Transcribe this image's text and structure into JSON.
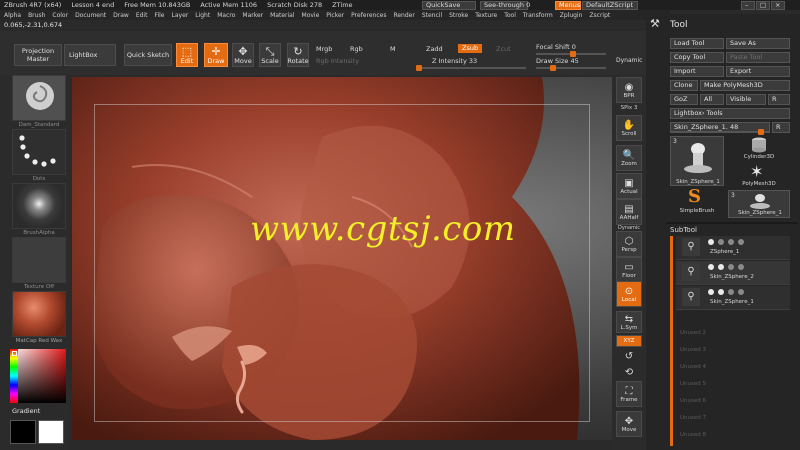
{
  "titlebar": {
    "app": "ZBrush 4R7 (x64)",
    "doc": "Lesson 4 end",
    "free_mem": "Free Mem 10.843GB",
    "active_mem": "Active Mem 1106",
    "scratch": "Scratch Disk 278",
    "ztime": "ZTime",
    "quicksave": "QuickSave",
    "see_through": "See-through",
    "see_through_value": "0",
    "menus": "Menus",
    "script": "DefaultZScript"
  },
  "menu": [
    "Alpha",
    "Brush",
    "Color",
    "Document",
    "Draw",
    "Edit",
    "File",
    "Layer",
    "Light",
    "Macro",
    "Marker",
    "Material",
    "Movie",
    "Picker",
    "Preferences",
    "Render",
    "Stencil",
    "Stroke",
    "Texture",
    "Tool",
    "Transform",
    "Zplugin",
    "Zscript"
  ],
  "coords": "0.065,-2.31,0.674",
  "toolbar": {
    "projection_master": "Projection Master",
    "lightbox": "LightBox",
    "quick_sketch": "Quick Sketch",
    "edit": "Edit",
    "draw": "Draw",
    "move": "Move",
    "scale": "Scale",
    "rotate": "Rotate",
    "mrgb": "Mrgb",
    "rgb": "Rgb",
    "m": "M",
    "rgb_intensity": "Rgb Intensity",
    "zadd": "Zadd",
    "zsub": "Zsub",
    "zcut": "Zcut",
    "z_intensity_label": "Z Intensity",
    "z_intensity": "33",
    "focal_shift_label": "Focal Shift",
    "focal_shift": "0",
    "draw_size_label": "Draw Size",
    "draw_size": "45",
    "dynamic": "Dynamic"
  },
  "left": {
    "brush": "Dam_Standard",
    "stroke": "Dots",
    "alpha": "BrushAlpha",
    "texture": "Texture Off",
    "material": "MatCap Red Wax",
    "gradient": "Gradient"
  },
  "viewport": {
    "watermark": "www.cgtsj.com"
  },
  "rightstrip": {
    "bpr": "BPR",
    "spix_label": "SPix",
    "spix": "3",
    "scroll": "Scroll",
    "zoom": "Zoom",
    "actual": "Actual",
    "aahalf": "AAHalf",
    "dynamic": "Dynamic",
    "persp": "Persp",
    "floor": "Floor",
    "local": "Local",
    "lsym": "L.Sym",
    "xyz": "XYZ",
    "frame": "Frame",
    "move": "Move"
  },
  "tool": {
    "title": "Tool",
    "load_tool": "Load Tool",
    "save_as": "Save As",
    "copy_tool": "Copy Tool",
    "paste_tool": "Paste Tool",
    "import": "Import",
    "export": "Export",
    "clone": "Clone",
    "make_polymesh": "Make PolyMesh3D",
    "goz": "GoZ",
    "all": "All",
    "visible": "Visible",
    "r": "R",
    "lightbox_tools": "Lightbox› Tools",
    "current_tool": "Skin_ZSphere_1.",
    "current_tool_value": "48",
    "r2": "R",
    "card_main_count": "3",
    "card_main": "Skin_ZSphere_1",
    "card_cyl": "Cylinder3D",
    "card_poly": "PolyMesh3D",
    "card_simple": "SimpleBrush",
    "card_skin_count": "3",
    "card_skin": "Skin_ZSphere_1"
  },
  "subtool": {
    "title": "SubTool",
    "items": [
      "ZSphere_1",
      "Skin_ZSphere_2",
      "Skin_ZSphere_1"
    ],
    "unused": [
      "Unused 2",
      "Unused 3",
      "Unused 4",
      "Unused 5",
      "Unused 6",
      "Unused 7",
      "Unused 8"
    ]
  }
}
